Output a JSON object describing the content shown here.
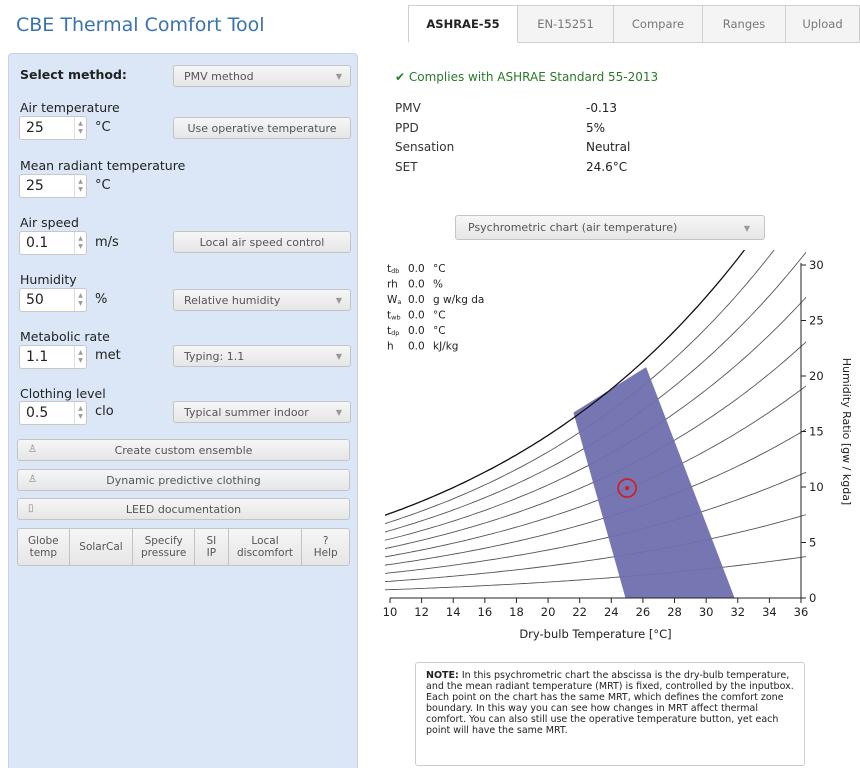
{
  "app_title": "CBE Thermal Comfort Tool",
  "tabs": [
    {
      "label": "ASHRAE-55",
      "active": true
    },
    {
      "label": "EN-15251",
      "active": false
    },
    {
      "label": "Compare",
      "active": false
    },
    {
      "label": "Ranges",
      "active": false
    },
    {
      "label": "Upload",
      "active": false
    }
  ],
  "inputs": {
    "method_label": "Select method:",
    "method_value": "PMV method",
    "air_temp": {
      "label": "Air temperature",
      "value": "25",
      "unit": "°C",
      "button": "Use operative temperature"
    },
    "mrt": {
      "label": "Mean radiant temperature",
      "value": "25",
      "unit": "°C"
    },
    "air_speed": {
      "label": "Air speed",
      "value": "0.1",
      "unit": "m/s",
      "button": "Local air speed control"
    },
    "humidity": {
      "label": "Humidity",
      "value": "50",
      "unit": "%",
      "select": "Relative humidity"
    },
    "met": {
      "label": "Metabolic rate",
      "value": "1.1",
      "unit": "met",
      "select": "Typing: 1.1"
    },
    "clo": {
      "label": "Clothing level",
      "value": "0.5",
      "unit": "clo",
      "select": "Typical summer indoor"
    }
  },
  "actions": {
    "custom_ensemble": "Create custom ensemble",
    "dynamic_clothing": "Dynamic predictive clothing",
    "leed": "LEED documentation",
    "group": [
      {
        "line1": "Globe",
        "line2": "temp"
      },
      {
        "line1": "SolarCal",
        "line2": ""
      },
      {
        "line1": "Specify",
        "line2": "pressure"
      },
      {
        "line1": "SI",
        "line2": "IP"
      },
      {
        "line1": "Local",
        "line2": "discomfort"
      },
      {
        "line1": "?",
        "line2": "Help"
      }
    ]
  },
  "results": {
    "complies": "Complies with ASHRAE Standard 55-2013",
    "rows": [
      {
        "label": "PMV",
        "value": "-0.13"
      },
      {
        "label": "PPD",
        "value": "5%"
      },
      {
        "label": "Sensation",
        "value": "Neutral"
      },
      {
        "label": "SET",
        "value": "24.6°C"
      }
    ]
  },
  "chart_select": "Psychrometric chart (air temperature)",
  "readout": [
    {
      "sym": "t",
      "sub": "db",
      "value": "0.0",
      "unit": "°C"
    },
    {
      "sym": "rh",
      "sub": "",
      "value": "0.0",
      "unit": "%"
    },
    {
      "sym": "W",
      "sub": "a",
      "value": "0.0",
      "unit": "g w/kg da"
    },
    {
      "sym": "t",
      "sub": "wb",
      "value": "0.0",
      "unit": "°C"
    },
    {
      "sym": "t",
      "sub": "dp",
      "value": "0.0",
      "unit": "°C"
    },
    {
      "sym": "h",
      "sub": "",
      "value": "0.0",
      "unit": "kJ/kg"
    }
  ],
  "chart_data": {
    "type": "line",
    "title": "",
    "xlabel": "Dry-bulb Temperature [°C]",
    "ylabel": "Humidity Ratio [gw / kgda]",
    "xlim": [
      10,
      36
    ],
    "ylim": [
      0,
      30
    ],
    "x_ticks": [
      10,
      12,
      14,
      16,
      18,
      20,
      22,
      24,
      26,
      28,
      30,
      32,
      34,
      36
    ],
    "y_ticks": [
      0,
      5,
      10,
      15,
      20,
      25,
      30
    ],
    "rh_curves": [
      10,
      20,
      30,
      40,
      50,
      60,
      70,
      80,
      90,
      100
    ],
    "comfort_zone": [
      [
        21.6,
        16.7
      ],
      [
        26.2,
        20.8
      ],
      [
        31.8,
        0
      ],
      [
        24.9,
        0
      ]
    ],
    "point": {
      "x": 25,
      "y": 9.9
    },
    "zone_color": "#6e6fae",
    "point_color": "#d7191c"
  },
  "note": {
    "bold": "NOTE:",
    "text": " In this psychrometric chart the abscissa is the dry-bulb temperature, and the mean radiant temperature (MRT) is fixed, controlled by the inputbox. Each point on the chart has the same MRT, which defines the comfort zone boundary. In this way you can see how changes in MRT affect thermal comfort. You can also still use the operative temperature button, yet each point will have the same MRT."
  }
}
